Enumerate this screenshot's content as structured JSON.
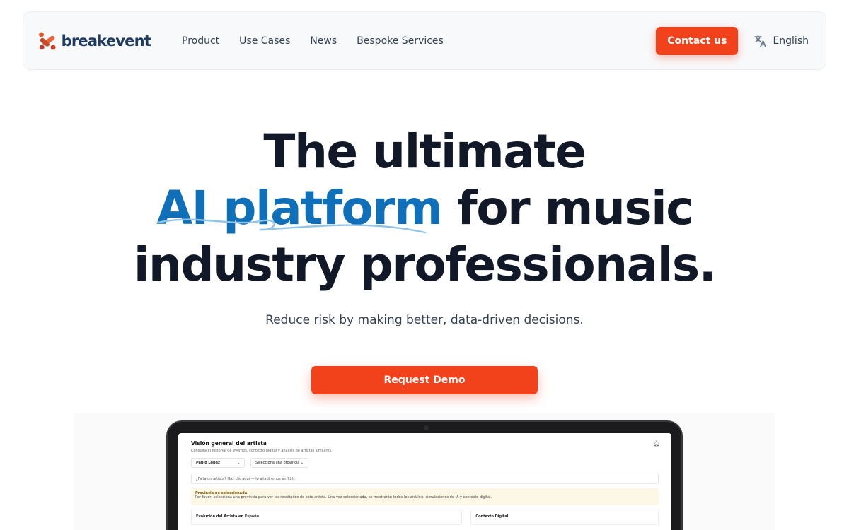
{
  "brand": {
    "name": "breakevent",
    "logo_icon": "breakevent-logo-icon",
    "logo_colors": [
      "#e2572e",
      "#c43e25"
    ]
  },
  "nav": {
    "links": [
      "Product",
      "Use Cases",
      "News",
      "Bespoke Services"
    ],
    "contact_label": "Contact us",
    "language": "English",
    "language_icon": "translate-icon"
  },
  "hero": {
    "line1": "The ultimate",
    "line2_highlight": "AI platform",
    "line2_rest": "for music",
    "line3": "industry professionals.",
    "subtitle": "Reduce risk by making better, data-driven decisions.",
    "cta_label": "Request Demo"
  },
  "dashboard_preview": {
    "title": "Visión general del artista",
    "subtitle": "Consulta el historial de eventos, contexto digital y análisis de artistas similares.",
    "artist_select": "Pablo López",
    "province_select": "Selecciona una provincia",
    "missing_artist_note": "¿Falta un artista? Haz clic aquí — lo añadiremos en 72h.",
    "warning_title": "Provincia no seleccionada",
    "warning_text": "Por favor, selecciona una provincia para ver los resultados de este artista. Una vez seleccionada, se mostrarán todos los análisis, simulaciones de IA y contexto digital.",
    "card1_title": "Evolución del Artista en España",
    "card2_title": "Contexto Digital"
  },
  "colors": {
    "accent": "#f2421c",
    "highlight": "#0f6fb8",
    "heading": "#111827"
  }
}
